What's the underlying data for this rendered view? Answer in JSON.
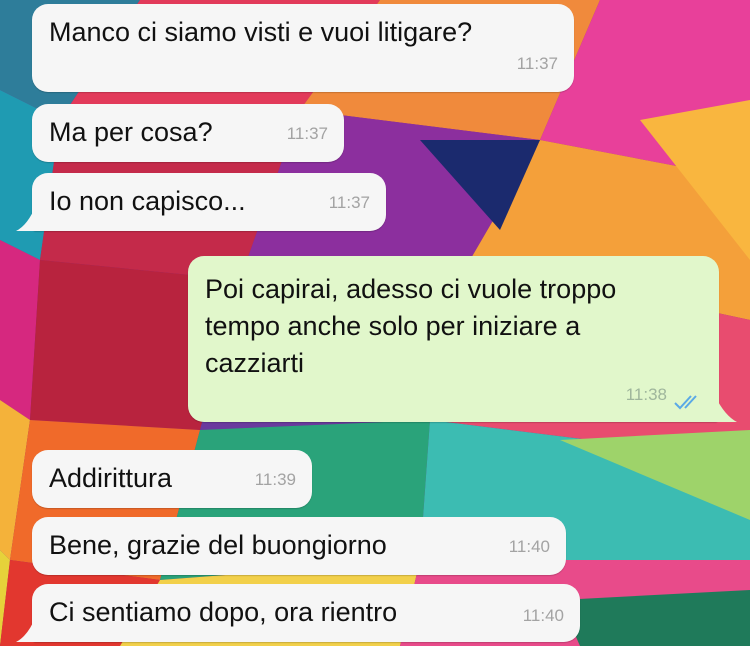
{
  "colors": {
    "incoming_bubble": "#f6f6f6",
    "outgoing_bubble": "#e1f7cb",
    "read_ticks": "#5aa9e6"
  },
  "messages": [
    {
      "direction": "incoming",
      "text": "Manco ci siamo visti e vuoi litigare?",
      "time": "11:37"
    },
    {
      "direction": "incoming",
      "text": "Ma per cosa?",
      "time": "11:37"
    },
    {
      "direction": "incoming",
      "text": "Io non capisco...",
      "time": "11:37"
    },
    {
      "direction": "outgoing",
      "lines": [
        "Poi capirai, adesso ci vuole troppo",
        "tempo anche solo per iniziare a",
        "cazziarti"
      ],
      "time": "11:38",
      "status": "read",
      "status_icon": "double-check-icon"
    },
    {
      "direction": "incoming",
      "text": "Addirittura",
      "time": "11:39"
    },
    {
      "direction": "incoming",
      "text": "Bene, grazie del buongiorno",
      "time": "11:40"
    },
    {
      "direction": "incoming",
      "text": "Ci sentiamo dopo, ora rientro",
      "time": "11:40"
    }
  ]
}
